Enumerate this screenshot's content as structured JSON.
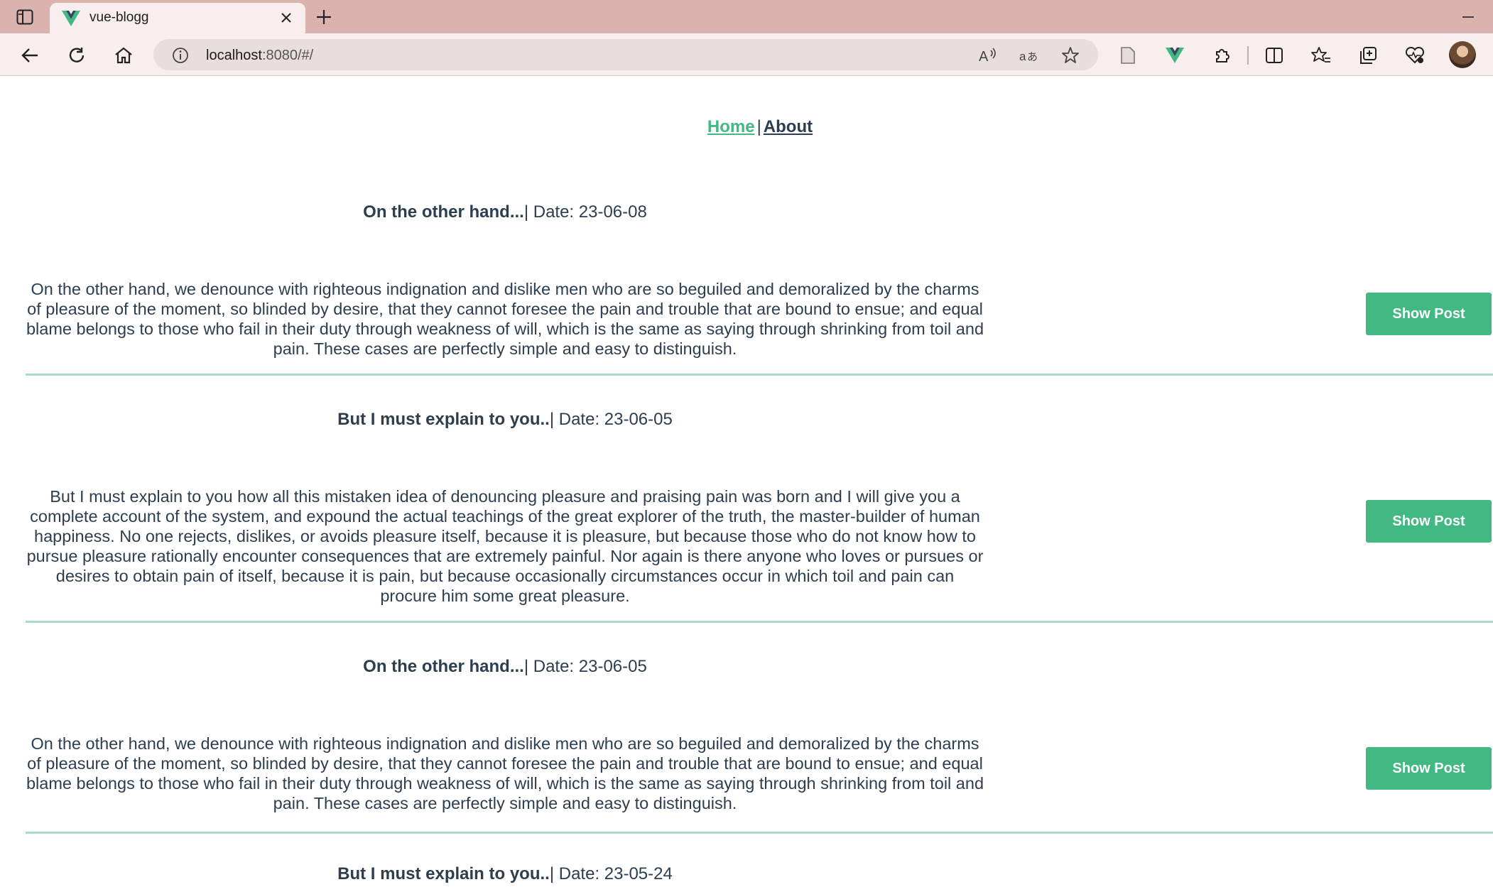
{
  "browser": {
    "tab_title": "vue-blogg",
    "url_host": "localhost",
    "url_rest": ":8080/#/"
  },
  "nav": {
    "home": "Home",
    "separator": "|",
    "about": "About"
  },
  "posts": [
    {
      "title": "On the other hand...",
      "date_label": "| Date: 23-06-08",
      "body": "On the other hand, we denounce with righteous indignation and dislike men who are so beguiled and demoralized by the charms of pleasure of the moment, so blinded by desire, that they cannot foresee the pain and trouble that are bound to ensue; and equal blame belongs to those who fail in their duty through weakness of will, which is the same as saying through shrinking from toil and pain. These cases are perfectly simple and easy to distinguish.",
      "button": "Show Post"
    },
    {
      "title": "But I must explain to you..",
      "date_label": "| Date: 23-06-05",
      "body": "But I must explain to you how all this mistaken idea of denouncing pleasure and praising pain was born and I will give you a complete account of the system, and expound the actual teachings of the great explorer of the truth, the master-builder of human happiness. No one rejects, dislikes, or avoids pleasure itself, because it is pleasure, but because those who do not know how to pursue pleasure rationally encounter consequences that are extremely painful. Nor again is there anyone who loves or pursues or desires to obtain pain of itself, because it is pain, but because occasionally circumstances occur in which toil and pain can procure him some great pleasure.",
      "button": "Show Post"
    },
    {
      "title": "On the other hand...",
      "date_label": "| Date: 23-06-05",
      "body": "On the other hand, we denounce with righteous indignation and dislike men who are so beguiled and demoralized by the charms of pleasure of the moment, so blinded by desire, that they cannot foresee the pain and trouble that are bound to ensue; and equal blame belongs to those who fail in their duty through weakness of will, which is the same as saying through shrinking from toil and pain. These cases are perfectly simple and easy to distinguish.",
      "button": "Show Post"
    },
    {
      "title": "But I must explain to you..",
      "date_label": "| Date: 23-05-24"
    }
  ],
  "colors": {
    "accent": "#42b983",
    "text": "#2c3e50",
    "divider": "#a9dcc8",
    "tabbar": "#dbb3ae",
    "toolbar": "#f8eeee"
  },
  "icons": {
    "toolbar": [
      "back-icon",
      "refresh-icon",
      "home-icon",
      "site-info-icon",
      "read-aloud-icon",
      "translate-icon",
      "favorite-star-icon",
      "page-icon",
      "vue-devtools-icon",
      "extensions-icon",
      "split-screen-icon",
      "favorites-icon",
      "collections-icon",
      "browser-essentials-icon"
    ]
  }
}
